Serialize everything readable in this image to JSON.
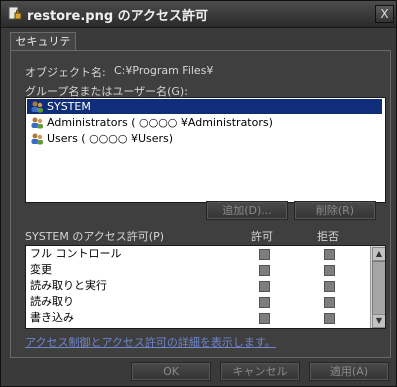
{
  "window": {
    "title": "restore.png のアクセス許可",
    "close_glyph": "X"
  },
  "tab": {
    "label": "セキュリティ"
  },
  "object": {
    "label": "オブジェクト名:",
    "value": "C:¥Program Files¥"
  },
  "group_list": {
    "label": "グループ名またはユーザー名(G):",
    "items": [
      {
        "label": "SYSTEM",
        "selected": true
      },
      {
        "label": "Administrators ( ○○○○ ¥Administrators)",
        "selected": false
      },
      {
        "label": "Users ( ○○○○ ¥Users)",
        "selected": false
      }
    ]
  },
  "buttons": {
    "add": "追加(D)...",
    "remove": "削除(R)",
    "ok": "OK",
    "cancel": "キャンセル",
    "apply": "適用(A)"
  },
  "permissions": {
    "header": "SYSTEM のアクセス許可(P)",
    "allow_header": "許可",
    "deny_header": "拒否",
    "rows": [
      {
        "name": "フル コントロール"
      },
      {
        "name": "変更"
      },
      {
        "name": "読み取りと実行"
      },
      {
        "name": "読み取り"
      },
      {
        "name": "書き込み"
      }
    ]
  },
  "link": {
    "label": "アクセス制御とアクセス許可の詳細を表示します。"
  },
  "colors": {
    "selection": "#102d7a",
    "link": "#6d85c9"
  },
  "icons": {
    "title": "lock-document-icon",
    "user": "user-group-icon"
  }
}
